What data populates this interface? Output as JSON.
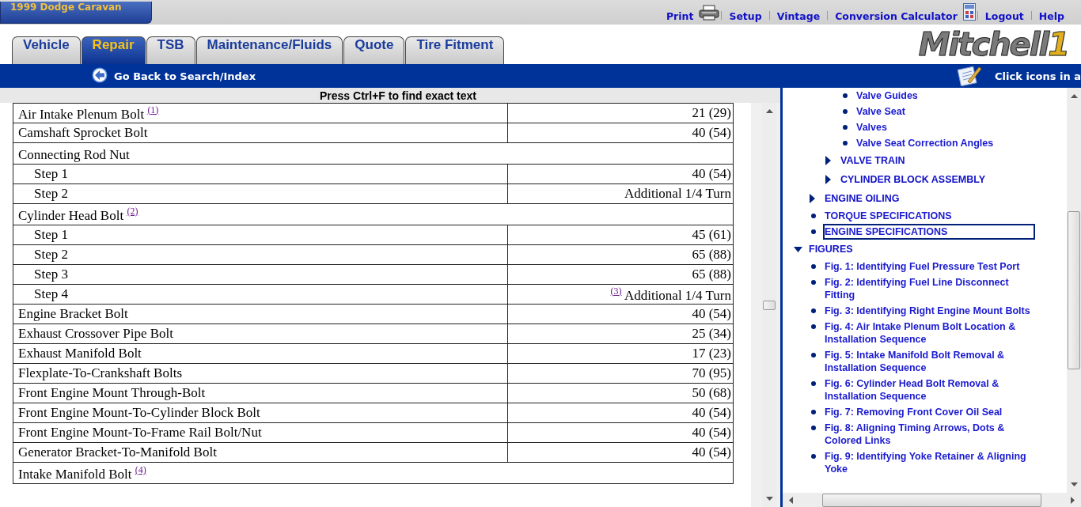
{
  "vehicle": "1999 Dodge Caravan",
  "top_links": [
    {
      "label": "Print",
      "kind": "printer"
    },
    {
      "label": "Setup"
    },
    {
      "label": "Vintage"
    },
    {
      "label": "Conversion Calculator",
      "kind": "calculator"
    },
    {
      "label": "Logout"
    },
    {
      "label": "Help"
    }
  ],
  "tabs": [
    {
      "label": "Vehicle",
      "selected": false
    },
    {
      "label": "Repair",
      "selected": true
    },
    {
      "label": "TSB",
      "selected": false
    },
    {
      "label": "Maintenance/Fluids",
      "selected": false
    },
    {
      "label": "Quote",
      "selected": false
    },
    {
      "label": "Tire Fitment",
      "selected": false
    }
  ],
  "logo": {
    "text": "Mitchell",
    "mark": "1"
  },
  "nav_bar": {
    "back_link": "Go Back to Search/Index",
    "hint": "Click icons in a"
  },
  "content": {
    "find_hint": "Press Ctrl+F to find exact text",
    "rows": [
      {
        "label": "Air Intake Plenum Bolt",
        "note": "(1)",
        "value": "21 (29)"
      },
      {
        "label": "Camshaft Sprocket Bolt",
        "value": "40 (54)"
      },
      {
        "label": "Connecting Rod Nut",
        "children": [
          {
            "label": "Step 1",
            "value": "40 (54)"
          },
          {
            "label": "Step 2",
            "value": "Additional 1/4 Turn"
          }
        ]
      },
      {
        "label": "Cylinder Head Bolt",
        "note": "(2)",
        "children": [
          {
            "label": "Step 1",
            "value": "45 (61)"
          },
          {
            "label": "Step 2",
            "value": "65 (88)"
          },
          {
            "label": "Step 3",
            "value": "65 (88)"
          },
          {
            "label": "Step 4",
            "value_note": "(3)",
            "value": "Additional 1/4 Turn"
          }
        ]
      },
      {
        "label": "Engine Bracket Bolt",
        "value": "40 (54)"
      },
      {
        "label": "Exhaust Crossover Pipe Bolt",
        "value": "25 (34)"
      },
      {
        "label": "Exhaust Manifold Bolt",
        "value": "17 (23)"
      },
      {
        "label": "Flexplate-To-Crankshaft Bolts",
        "value": "70 (95)"
      },
      {
        "label": "Front Engine Mount Through-Bolt",
        "value": "50 (68)"
      },
      {
        "label": "Front Engine Mount-To-Cylinder Block Bolt",
        "value": "40 (54)"
      },
      {
        "label": "Front Engine Mount-To-Frame Rail Bolt/Nut",
        "value": "40 (54)"
      },
      {
        "label": "Generator Bracket-To-Manifold Bolt",
        "value": "40 (54)"
      },
      {
        "label": "Intake Manifold Bolt",
        "note": "(4)"
      }
    ]
  },
  "toc": [
    {
      "children": [
        {
          "children": [
            {
              "children": [
                {
                  "label": "Valve Guides",
                  "kind": "leaf",
                  "selected": false
                },
                {
                  "label": "Valve Seat",
                  "kind": "leaf",
                  "selected": false
                },
                {
                  "label": "Valves",
                  "kind": "leaf",
                  "selected": false
                },
                {
                  "label": "Valve Seat Correction Angles",
                  "kind": "leaf",
                  "selected": false
                }
              ]
            },
            {
              "label": "VALVE TRAIN",
              "kind": "branch",
              "expanded": false,
              "selected": false
            },
            {
              "label": "CYLINDER BLOCK ASSEMBLY",
              "kind": "branch",
              "expanded": false,
              "selected": false
            }
          ]
        },
        {
          "label": "ENGINE OILING",
          "kind": "branch",
          "expanded": false,
          "selected": false
        },
        {
          "label": "TORQUE SPECIFICATIONS",
          "kind": "leaf",
          "selected": false
        },
        {
          "label": "ENGINE SPECIFICATIONS",
          "kind": "leaf",
          "selected": true
        }
      ]
    },
    {
      "label": "FIGURES",
      "kind": "branch",
      "expanded": true,
      "selected": false,
      "children": [
        {
          "label": "Fig. 1: Identifying Fuel Pressure Test Port",
          "kind": "leaf",
          "selected": false
        },
        {
          "label": "Fig. 2: Identifying Fuel Line Disconnect Fitting",
          "kind": "leaf",
          "selected": false
        },
        {
          "label": "Fig. 3: Identifying Right Engine Mount Bolts",
          "kind": "leaf",
          "selected": false
        },
        {
          "label": "Fig. 4: Air Intake Plenum Bolt Location & Installation Sequence",
          "kind": "leaf",
          "selected": false
        },
        {
          "label": "Fig. 5: Intake Manifold Bolt Removal & Installation Sequence",
          "kind": "leaf",
          "selected": false
        },
        {
          "label": "Fig. 6: Cylinder Head Bolt Removal & Installation Sequence",
          "kind": "leaf",
          "selected": false
        },
        {
          "label": "Fig. 7: Removing Front Cover Oil Seal",
          "kind": "leaf",
          "selected": false
        },
        {
          "label": "Fig. 8: Aligning Timing Arrows, Dots & Colored Links",
          "kind": "leaf",
          "selected": false
        },
        {
          "label": "Fig. 9: Identifying Yoke Retainer & Aligning Yoke",
          "kind": "leaf",
          "selected": false
        }
      ]
    }
  ]
}
